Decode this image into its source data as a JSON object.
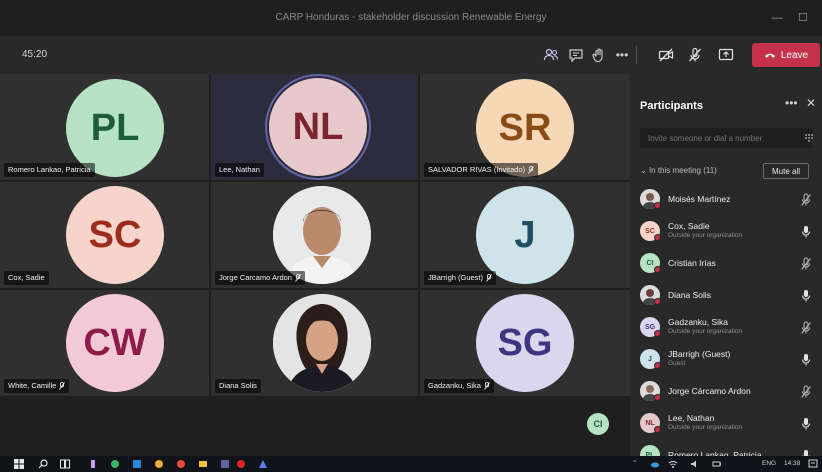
{
  "window": {
    "title": "CARP Honduras - stakeholder discussion Renewable Energy"
  },
  "toolbar": {
    "timer": "45:20",
    "icons": [
      "participants-icon",
      "chat-icon",
      "raise-hand-icon",
      "more-icon",
      "camera-off-icon",
      "mic-off-icon",
      "share-icon"
    ],
    "leave_label": "Leave"
  },
  "grid": {
    "tiles": [
      {
        "name": "Romero Lankao, Patricia",
        "initials": "PL",
        "bg": "#b6e3c5",
        "fg": "#1e5b38",
        "mic": false
      },
      {
        "name": "Lee, Nathan",
        "initials": "NL",
        "bg": "#e7c9cc",
        "fg": "#7b2430",
        "mic": false
      },
      {
        "name": "SALVADOR RIVAS (Invitado)",
        "initials": "SR",
        "bg": "#f6d8b6",
        "fg": "#8a4c16",
        "mic": true
      },
      {
        "name": "Cox, Sadie",
        "initials": "SC",
        "bg": "#f6d4cc",
        "fg": "#9c2d1c",
        "mic": false
      },
      {
        "name": "Jorge Carcamo Ardon",
        "initials": "",
        "bg": "#e4e4e4",
        "fg": "#333",
        "mic": true
      },
      {
        "name": "JBarrigh (Guest)",
        "initials": "J",
        "bg": "#cfe3ea",
        "fg": "#1f4f60",
        "mic": true
      },
      {
        "name": "White, Camille",
        "initials": "CW",
        "bg": "#f3c9d8",
        "fg": "#8c1d48",
        "mic": true
      },
      {
        "name": "Diana Solis",
        "initials": "",
        "bg": "#e4e4e4",
        "fg": "#333",
        "mic": false
      },
      {
        "name": "Gadzanku, Sika",
        "initials": "SG",
        "bg": "#d9d6ee",
        "fg": "#3d3580",
        "mic": true
      }
    ],
    "overflow_initials": "CI"
  },
  "panel": {
    "title": "Participants",
    "invite_placeholder": "Invite someone or dial a number",
    "section_label": "In this meeting (11)",
    "mute_all_label": "Mute all",
    "participants": [
      {
        "name": "Moisés Martínez",
        "sub": "",
        "initials": "",
        "avatar": "photo",
        "bg": "#7a5a48",
        "muted": true
      },
      {
        "name": "Cox, Sadie",
        "sub": "Outside your organization",
        "initials": "SC",
        "avatar": "initials",
        "bg": "#f6d4cc",
        "fg": "#9c2d1c",
        "muted": false
      },
      {
        "name": "Cristian Irías",
        "sub": "",
        "initials": "CI",
        "avatar": "initials",
        "bg": "#b6e3c5",
        "fg": "#1e5b38",
        "muted": true
      },
      {
        "name": "Diana Solis",
        "sub": "",
        "initials": "",
        "avatar": "photo",
        "bg": "#6a3e3a",
        "muted": false
      },
      {
        "name": "Gadzanku, Sika",
        "sub": "Outside your organization",
        "initials": "SG",
        "avatar": "initials",
        "bg": "#d9d6ee",
        "fg": "#3d3580",
        "muted": true
      },
      {
        "name": "JBarrigh (Guest)",
        "sub": "Guest",
        "initials": "J",
        "avatar": "initials",
        "bg": "#cfe3ea",
        "fg": "#1f4f60",
        "muted": false
      },
      {
        "name": "Jorge Cárcamo Ardon",
        "sub": "",
        "initials": "",
        "avatar": "photo",
        "bg": "#8b6a55",
        "muted": true
      },
      {
        "name": "Lee, Nathan",
        "sub": "Outside your organization",
        "initials": "NL",
        "avatar": "initials",
        "bg": "#e7c9cc",
        "fg": "#7b2430",
        "muted": false
      },
      {
        "name": "Romero Lankao, Patricia",
        "sub": "",
        "initials": "PL",
        "avatar": "initials",
        "bg": "#b6e3c5",
        "fg": "#1e5b38",
        "muted": false
      }
    ]
  },
  "taskbar": {
    "apps": [
      "windows-icon",
      "search-icon",
      "task-view-icon",
      "app-icon",
      "app-icon",
      "app-icon",
      "app-icon",
      "app-icon",
      "app-icon",
      "app-icon",
      "app-icon"
    ],
    "lang": "ENG",
    "time": "14:38"
  }
}
